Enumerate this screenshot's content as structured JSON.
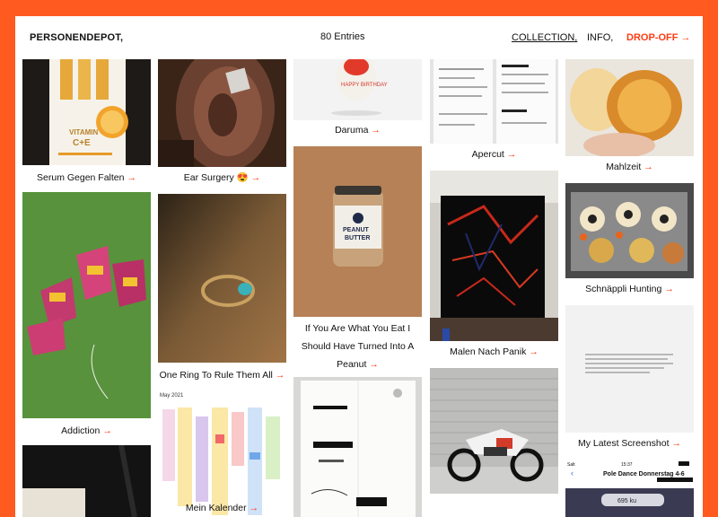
{
  "header": {
    "brand": "PERSONENDEPOT,",
    "entries": "80 Entries",
    "nav_collection": "COLLECTION,",
    "nav_info": "INFO,",
    "nav_drop": "DROP-OFF",
    "arrow": "→"
  },
  "items": {
    "serum": {
      "caption": "Serum Gegen Falten",
      "img_text_1": "VITAMIN",
      "img_text_2": "C+E"
    },
    "ear": {
      "caption": "Ear Surgery 😍"
    },
    "daruma": {
      "caption": "Daruma",
      "img_text": "HAPPY BIRTHDAY"
    },
    "apercut": {
      "caption": "Apercut"
    },
    "mahlzeit": {
      "caption": "Mahlzeit"
    },
    "addiction": {
      "caption": "Addiction"
    },
    "ring": {
      "caption": "One Ring To Rule Them All"
    },
    "peanut": {
      "caption_1": "If You Are What You Eat I",
      "caption_2": "Should Have Turned Into A",
      "caption_3": "Peanut",
      "jar_1": "PEANUT",
      "jar_2": "BUTTER"
    },
    "painting": {
      "caption": "Malen Nach Panik"
    },
    "schnappli": {
      "caption": "Schnäppli Hunting"
    },
    "screenshot": {
      "caption": "My Latest Screenshot"
    },
    "kalender": {
      "caption": "Mein Kalender",
      "month": "May 2021"
    },
    "phone": {
      "status_left": "Salt",
      "status_time": "15:37",
      "title": "Pole Dance Donnerstag 4-6",
      "amount": "695 ku"
    }
  }
}
